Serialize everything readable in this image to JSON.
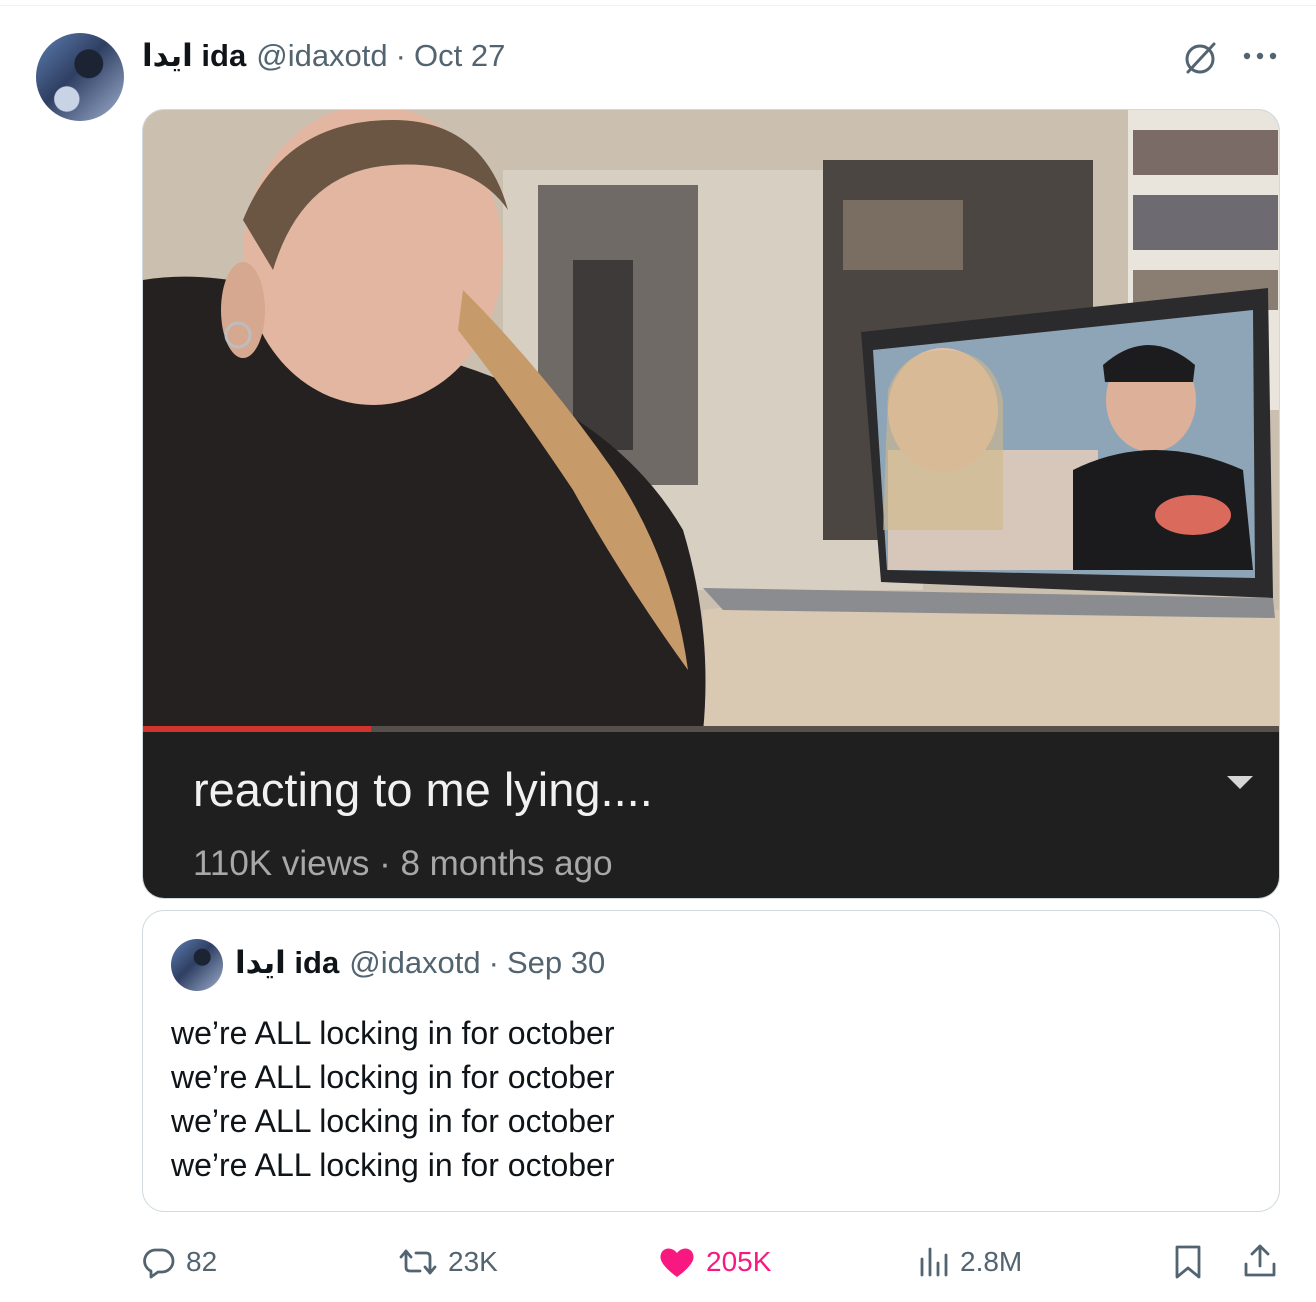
{
  "tweet": {
    "display_name": "ايدا ida",
    "handle": "@idaxotd",
    "separator": "·",
    "date": "Oct 27"
  },
  "media": {
    "video_title": "reacting to me lying....",
    "video_meta": "110K views · 8 months ago",
    "progress_fraction": 0.2
  },
  "quoted": {
    "display_name": "ايدا ida",
    "handle": "@idaxotd",
    "separator": "·",
    "date": "Sep 30",
    "lines": [
      "we’re ALL locking in for october",
      "we’re ALL locking in for october",
      "we’re ALL locking in for october",
      "we’re ALL locking in for october"
    ]
  },
  "actions": {
    "replies": "82",
    "reposts": "23K",
    "likes": "205K",
    "views": "2.8M"
  },
  "icons": {
    "reply": "reply-icon",
    "repost": "repost-icon",
    "like": "heart-icon",
    "views": "analytics-icon",
    "bookmark": "bookmark-icon",
    "share": "share-icon",
    "grok": "grok-icon",
    "more": "more-icon"
  },
  "colors": {
    "like": "#f91880",
    "muted": "#536471",
    "text": "#0f1419",
    "border": "#cfd9de",
    "progress": "#d0342c"
  }
}
